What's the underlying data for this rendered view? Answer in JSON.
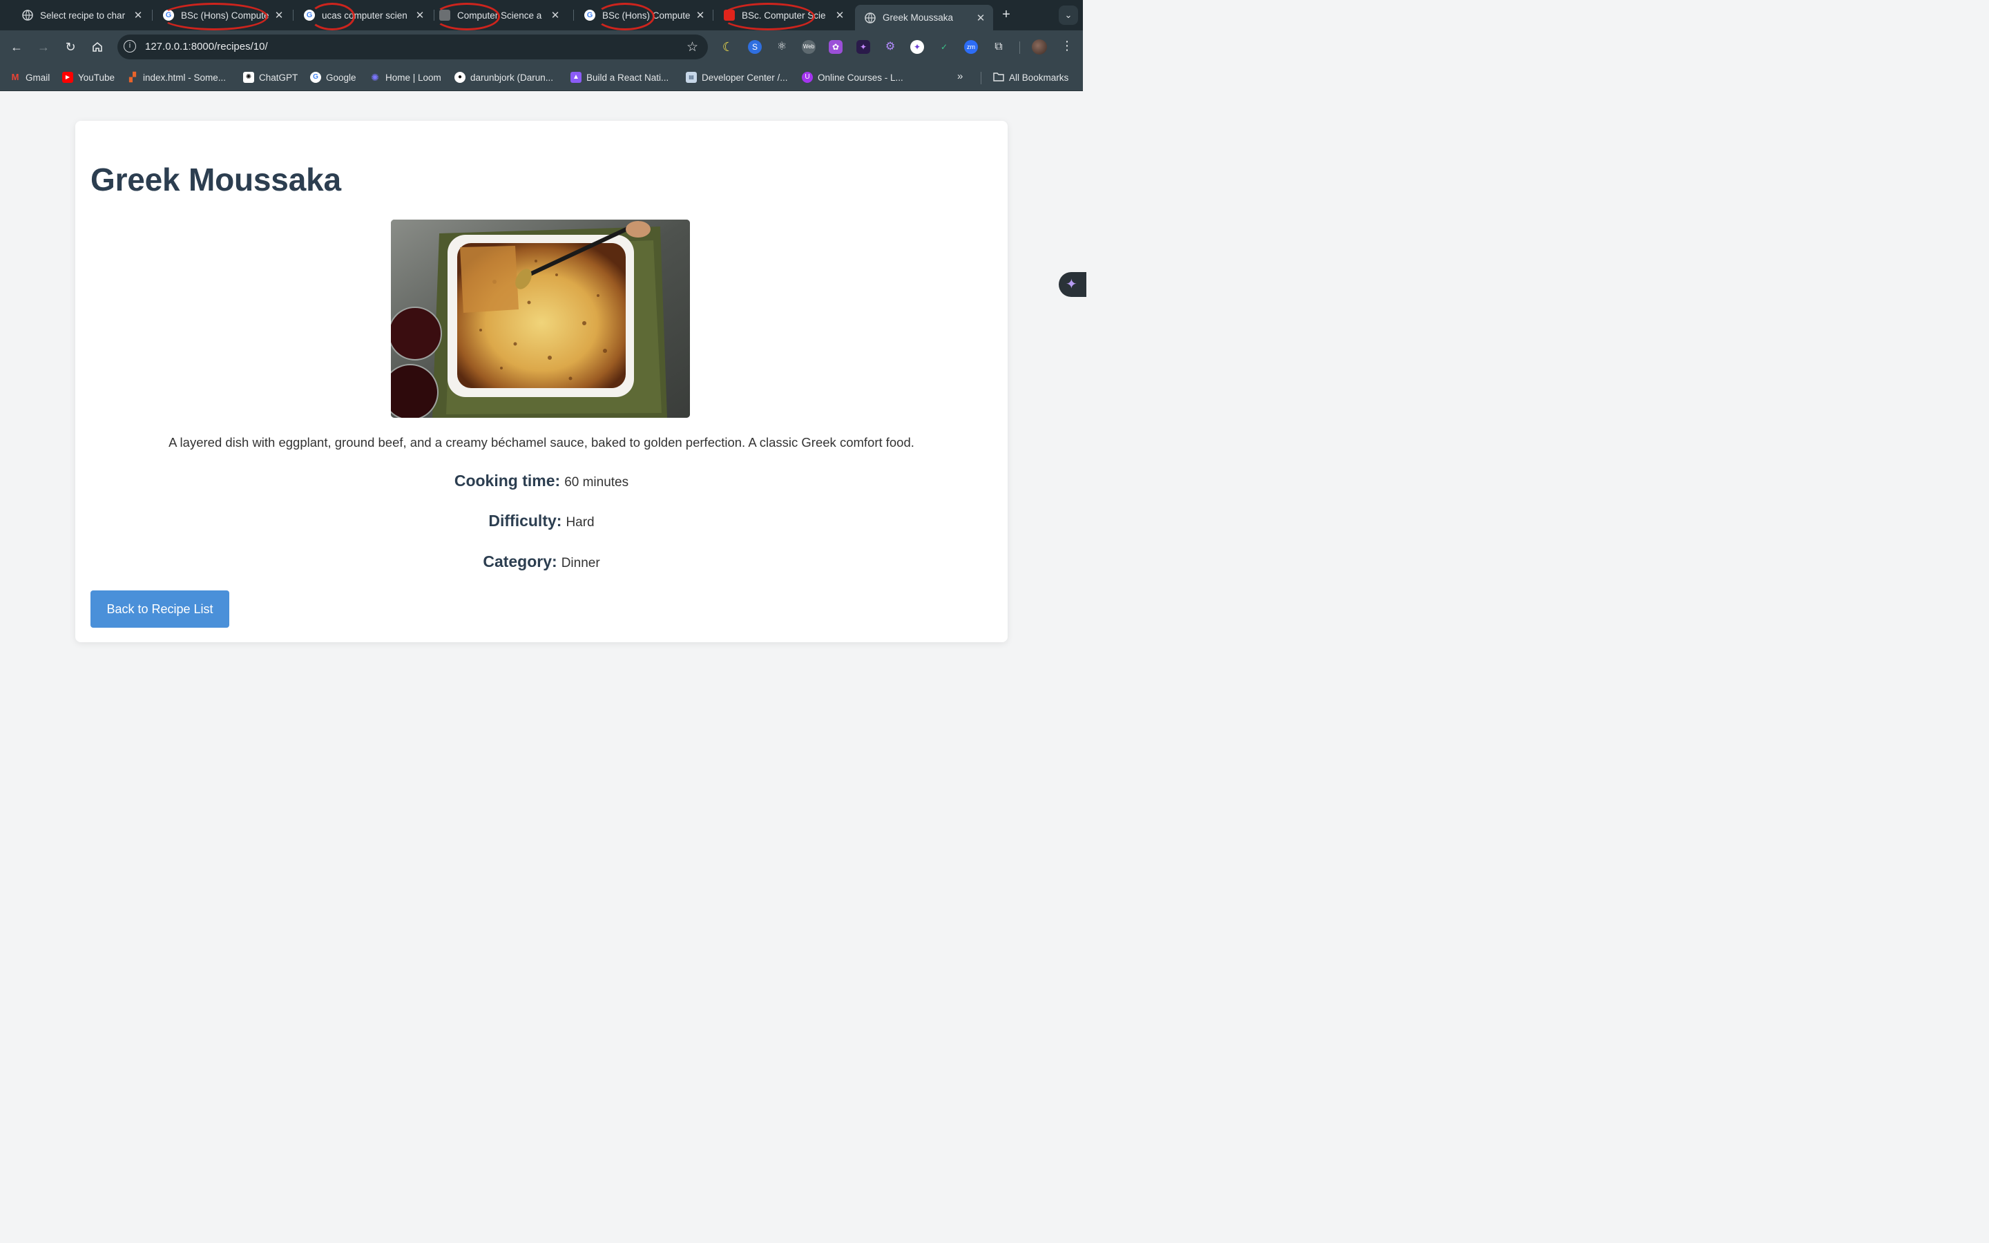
{
  "browser": {
    "tabs": [
      {
        "title": "Select recipe to char",
        "favicon": "globe-icon",
        "active": false
      },
      {
        "title": "BSc (Hons) Compute",
        "favicon": "google-icon",
        "active": false
      },
      {
        "title": "ucas computer scien",
        "favicon": "google-icon",
        "active": false
      },
      {
        "title": "Computer Science a",
        "favicon": "site-icon",
        "active": false
      },
      {
        "title": "BSc (Hons) Compute",
        "favicon": "google-icon",
        "active": false
      },
      {
        "title": "BSc. Computer Scie",
        "favicon": "site-icon",
        "active": false
      },
      {
        "title": "Greek Moussaka",
        "favicon": "globe-icon",
        "active": true
      }
    ],
    "url": "127.0.0.1:8000/recipes/10/",
    "bookmarks": [
      {
        "label": "Gmail",
        "icon": "gmail-icon",
        "color": "#ea4335"
      },
      {
        "label": "YouTube",
        "icon": "youtube-icon",
        "color": "#ff0000"
      },
      {
        "label": "index.html - Some...",
        "icon": "codesandbox-icon",
        "color": "#e8632b"
      },
      {
        "label": "ChatGPT",
        "icon": "chatgpt-icon",
        "color": "#ffffff"
      },
      {
        "label": "Google",
        "icon": "google-icon",
        "color": "#4285f4"
      },
      {
        "label": "Home | Loom",
        "icon": "loom-icon",
        "color": "#625df5"
      },
      {
        "label": "darunbjork (Darun...",
        "icon": "github-icon",
        "color": "#ffffff"
      },
      {
        "label": "Build a React Nati...",
        "icon": "rocket-icon",
        "color": "#8b5cf6"
      },
      {
        "label": "Developer Center /...",
        "icon": "devcenter-icon",
        "color": "#7aa7d9"
      },
      {
        "label": "Online Courses - L...",
        "icon": "udemy-icon",
        "color": "#a435f0"
      }
    ],
    "all_bookmarks": "All Bookmarks"
  },
  "recipe": {
    "title": "Greek Moussaka",
    "image_alt": "moussaka-photo",
    "description": "A layered dish with eggplant, ground beef, and a creamy béchamel sauce, baked to golden perfection. A classic Greek comfort food.",
    "cooking_time_label": "Cooking time:",
    "cooking_time": "60 minutes",
    "difficulty_label": "Difficulty:",
    "difficulty": "Hard",
    "category_label": "Category:",
    "category": "Dinner",
    "back_button": "Back to Recipe List"
  },
  "colors": {
    "heading": "#2c3e50",
    "button": "#4a90d9",
    "chrome_dark": "#1f2a30",
    "chrome_toolbar": "#37454d"
  }
}
